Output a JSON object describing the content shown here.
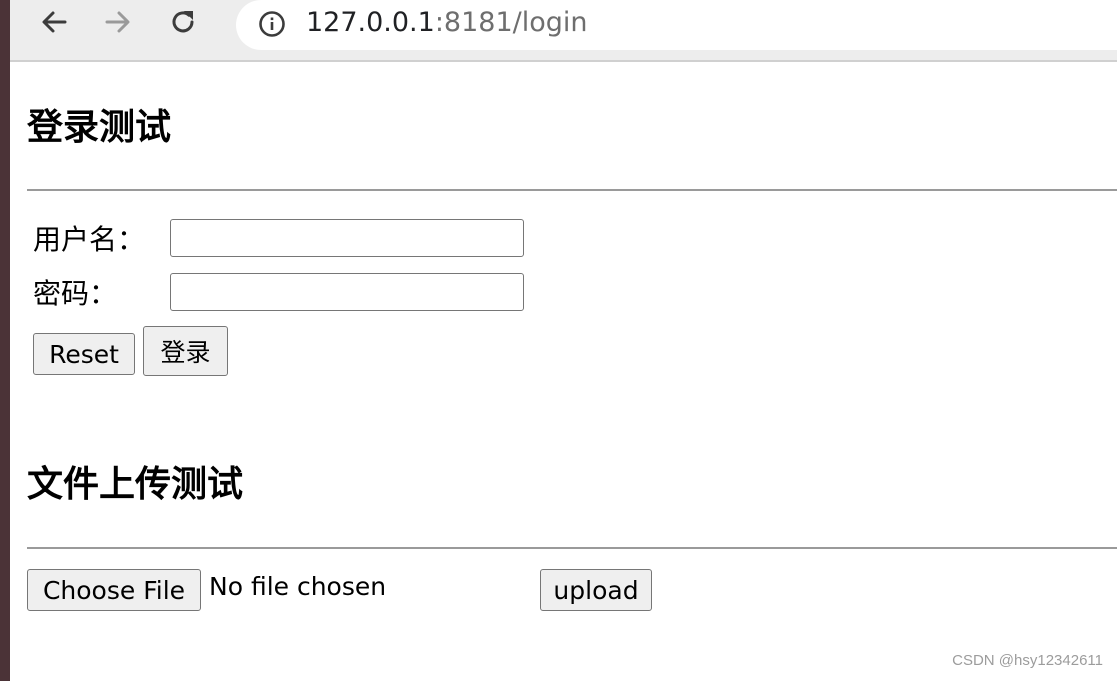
{
  "browser": {
    "url_host": "127.0.0.1",
    "url_rest": ":8181/login"
  },
  "login_section": {
    "heading": "登录测试",
    "username_label": "用户名：",
    "password_label": "密码：",
    "username_value": "",
    "password_value": "",
    "reset_label": "Reset",
    "submit_label": "登录"
  },
  "upload_section": {
    "heading": "文件上传测试",
    "choose_file_label": "Choose File",
    "file_status": "No file chosen",
    "upload_label": "upload"
  },
  "watermark": "CSDN @hsy12342611"
}
